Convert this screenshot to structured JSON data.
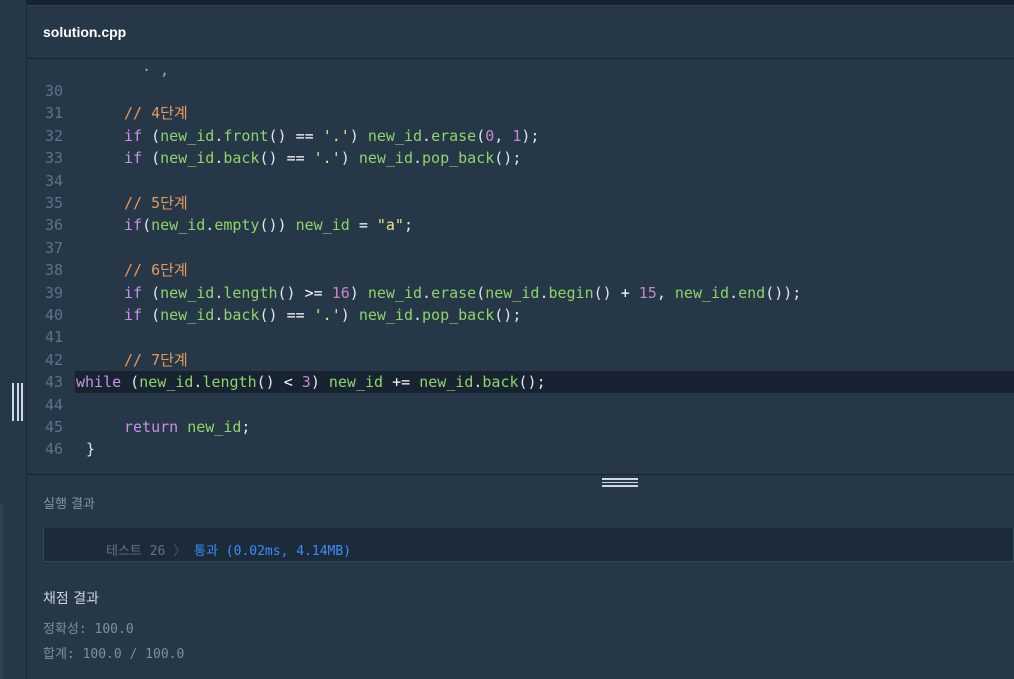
{
  "file": {
    "name": "solution.cpp"
  },
  "code": {
    "lines": [
      {
        "n": "30",
        "tokens": []
      },
      {
        "n": "31",
        "tokens": [
          [
            "cm",
            "// 4단계"
          ]
        ]
      },
      {
        "n": "32",
        "tokens": [
          [
            "kw",
            "if"
          ],
          [
            "pun",
            " ("
          ],
          [
            "id",
            "new_id"
          ],
          [
            "pun",
            "."
          ],
          [
            "fn",
            "front"
          ],
          [
            "pun",
            "() "
          ],
          [
            "op",
            "=="
          ],
          [
            "pun",
            " "
          ],
          [
            "str",
            "'.'"
          ],
          [
            "pun",
            ") "
          ],
          [
            "id",
            "new_id"
          ],
          [
            "pun",
            "."
          ],
          [
            "fn",
            "erase"
          ],
          [
            "pun",
            "("
          ],
          [
            "num",
            "0"
          ],
          [
            "pun",
            ", "
          ],
          [
            "num",
            "1"
          ],
          [
            "pun",
            ");"
          ]
        ]
      },
      {
        "n": "33",
        "tokens": [
          [
            "kw",
            "if"
          ],
          [
            "pun",
            " ("
          ],
          [
            "id",
            "new_id"
          ],
          [
            "pun",
            "."
          ],
          [
            "fn",
            "back"
          ],
          [
            "pun",
            "() "
          ],
          [
            "op",
            "=="
          ],
          [
            "pun",
            " "
          ],
          [
            "str",
            "'.'"
          ],
          [
            "pun",
            ") "
          ],
          [
            "id",
            "new_id"
          ],
          [
            "pun",
            "."
          ],
          [
            "fn",
            "pop_back"
          ],
          [
            "pun",
            "();"
          ]
        ]
      },
      {
        "n": "34",
        "tokens": []
      },
      {
        "n": "35",
        "tokens": [
          [
            "cm",
            "// 5단계"
          ]
        ]
      },
      {
        "n": "36",
        "tokens": [
          [
            "kw",
            "if"
          ],
          [
            "pun",
            "("
          ],
          [
            "id",
            "new_id"
          ],
          [
            "pun",
            "."
          ],
          [
            "fn",
            "empty"
          ],
          [
            "pun",
            "()) "
          ],
          [
            "id",
            "new_id"
          ],
          [
            "pun",
            " "
          ],
          [
            "op",
            "="
          ],
          [
            "pun",
            " "
          ],
          [
            "str",
            "\"a\""
          ],
          [
            "pun",
            ";"
          ]
        ]
      },
      {
        "n": "37",
        "tokens": []
      },
      {
        "n": "38",
        "tokens": [
          [
            "cm",
            "// 6단계"
          ]
        ]
      },
      {
        "n": "39",
        "tokens": [
          [
            "kw",
            "if"
          ],
          [
            "pun",
            " ("
          ],
          [
            "id",
            "new_id"
          ],
          [
            "pun",
            "."
          ],
          [
            "fn",
            "length"
          ],
          [
            "pun",
            "() "
          ],
          [
            "op",
            ">="
          ],
          [
            "pun",
            " "
          ],
          [
            "num",
            "16"
          ],
          [
            "pun",
            ") "
          ],
          [
            "id",
            "new_id"
          ],
          [
            "pun",
            "."
          ],
          [
            "fn",
            "erase"
          ],
          [
            "pun",
            "("
          ],
          [
            "id",
            "new_id"
          ],
          [
            "pun",
            "."
          ],
          [
            "fn",
            "begin"
          ],
          [
            "pun",
            "() "
          ],
          [
            "op",
            "+"
          ],
          [
            "pun",
            " "
          ],
          [
            "num",
            "15"
          ],
          [
            "pun",
            ", "
          ],
          [
            "id",
            "new_id"
          ],
          [
            "pun",
            "."
          ],
          [
            "fn",
            "end"
          ],
          [
            "pun",
            "());"
          ]
        ]
      },
      {
        "n": "40",
        "tokens": [
          [
            "kw",
            "if"
          ],
          [
            "pun",
            " ("
          ],
          [
            "id",
            "new_id"
          ],
          [
            "pun",
            "."
          ],
          [
            "fn",
            "back"
          ],
          [
            "pun",
            "() "
          ],
          [
            "op",
            "=="
          ],
          [
            "pun",
            " "
          ],
          [
            "str",
            "'.'"
          ],
          [
            "pun",
            ") "
          ],
          [
            "id",
            "new_id"
          ],
          [
            "pun",
            "."
          ],
          [
            "fn",
            "pop_back"
          ],
          [
            "pun",
            "();"
          ]
        ]
      },
      {
        "n": "41",
        "tokens": []
      },
      {
        "n": "42",
        "tokens": [
          [
            "cm",
            "// 7단계"
          ]
        ]
      },
      {
        "n": "43",
        "active": true,
        "tokens": [
          [
            "kw",
            "while"
          ],
          [
            "pun",
            " ("
          ],
          [
            "id",
            "new_id"
          ],
          [
            "pun",
            "."
          ],
          [
            "fn",
            "length"
          ],
          [
            "pun",
            "() "
          ],
          [
            "op",
            "<"
          ],
          [
            "pun",
            " "
          ],
          [
            "num",
            "3"
          ],
          [
            "pun",
            ") "
          ],
          [
            "id",
            "new_id"
          ],
          [
            "pun",
            " "
          ],
          [
            "op",
            "+="
          ],
          [
            "pun",
            " "
          ],
          [
            "id",
            "new_id"
          ],
          [
            "pun",
            "."
          ],
          [
            "fn",
            "back"
          ],
          [
            "pun",
            "();"
          ]
        ]
      },
      {
        "n": "44",
        "tokens": []
      },
      {
        "n": "45",
        "tokens": [
          [
            "kw",
            "return"
          ],
          [
            "pun",
            " "
          ],
          [
            "id",
            "new_id"
          ],
          [
            "pun",
            ";"
          ]
        ]
      },
      {
        "n": "46",
        "indent0": true,
        "tokens": [
          [
            "pun",
            "}"
          ]
        ]
      }
    ]
  },
  "results": {
    "title": "실행 결과",
    "test_label": "테스트 26",
    "test_chevron": "〉",
    "test_result": "통과 (0.02ms, 4.14MB)",
    "score_title": "채점 결과",
    "accuracy": "정확성: 100.0",
    "total": "합계: 100.0 / 100.0"
  }
}
